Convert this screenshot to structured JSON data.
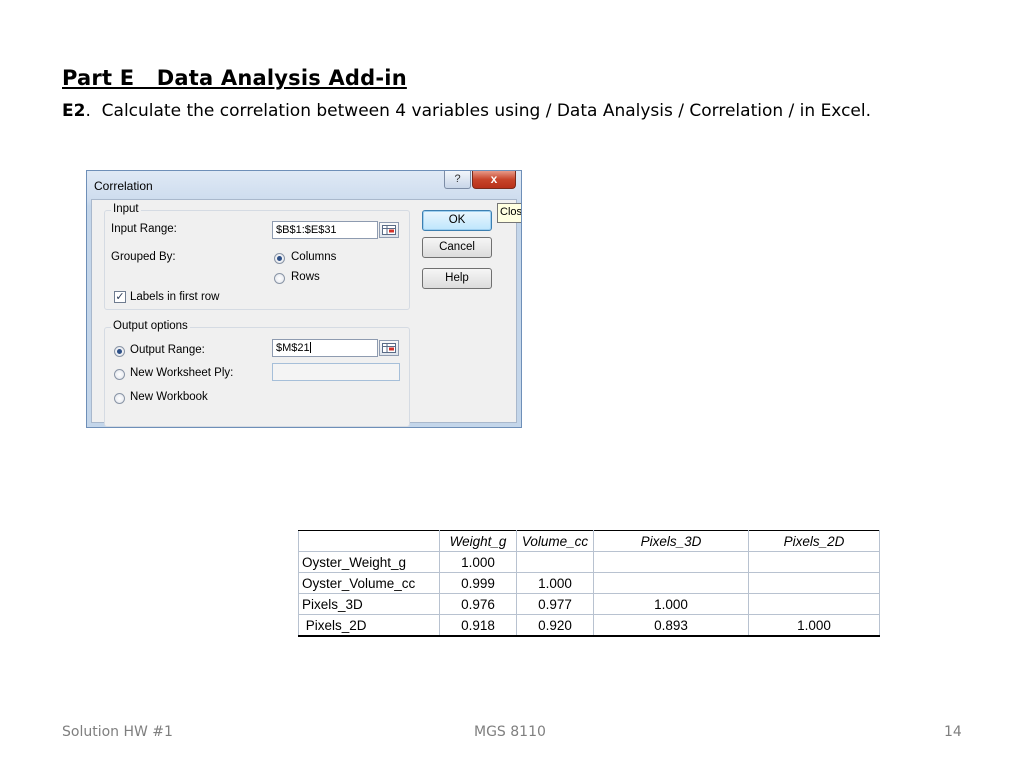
{
  "slide": {
    "title": "Part E   Data Analysis Add-in",
    "subtitle_id": "E2",
    "subtitle_text": ".  Calculate the correlation between 4 variables using / Data Analysis / Correlation / in Excel."
  },
  "dialog": {
    "title": "Correlation",
    "help_button": "?",
    "close_button": "x",
    "tooltip": "Clos",
    "input_group": {
      "label": "Input",
      "input_range_label": "Input Range:",
      "input_range_value": "$B$1:$E$31",
      "grouped_by_label": "Grouped By:",
      "columns_label": "Columns",
      "rows_label": "Rows",
      "grouped_by_selected": "Columns",
      "labels_first_row_label": "Labels in first row",
      "labels_first_row_checked": true
    },
    "output_group": {
      "label": "Output options",
      "output_range_label": "Output Range:",
      "output_range_value": "$M$21",
      "new_ply_label": "New Worksheet Ply:",
      "new_workbook_label": "New Workbook",
      "selected": "Output Range"
    },
    "buttons": {
      "ok": "OK",
      "cancel": "Cancel",
      "help": "Help"
    }
  },
  "correlation_table": {
    "headers": [
      "",
      "Weight_g",
      "Volume_cc",
      "Pixels_3D",
      "Pixels_2D"
    ],
    "rows": [
      {
        "label": "Oyster_Weight_g",
        "values": [
          "1.000",
          "",
          "",
          ""
        ]
      },
      {
        "label": "Oyster_Volume_cc",
        "values": [
          "0.999",
          "1.000",
          "",
          ""
        ]
      },
      {
        "label": "Pixels_3D",
        "values": [
          "0.976",
          "0.977",
          "1.000",
          ""
        ]
      },
      {
        "label": " Pixels_2D",
        "values": [
          "0.918",
          "0.920",
          "0.893",
          "1.000"
        ]
      }
    ]
  },
  "footer": {
    "left": "Solution HW #1",
    "center": "MGS 8110",
    "right": "14"
  }
}
